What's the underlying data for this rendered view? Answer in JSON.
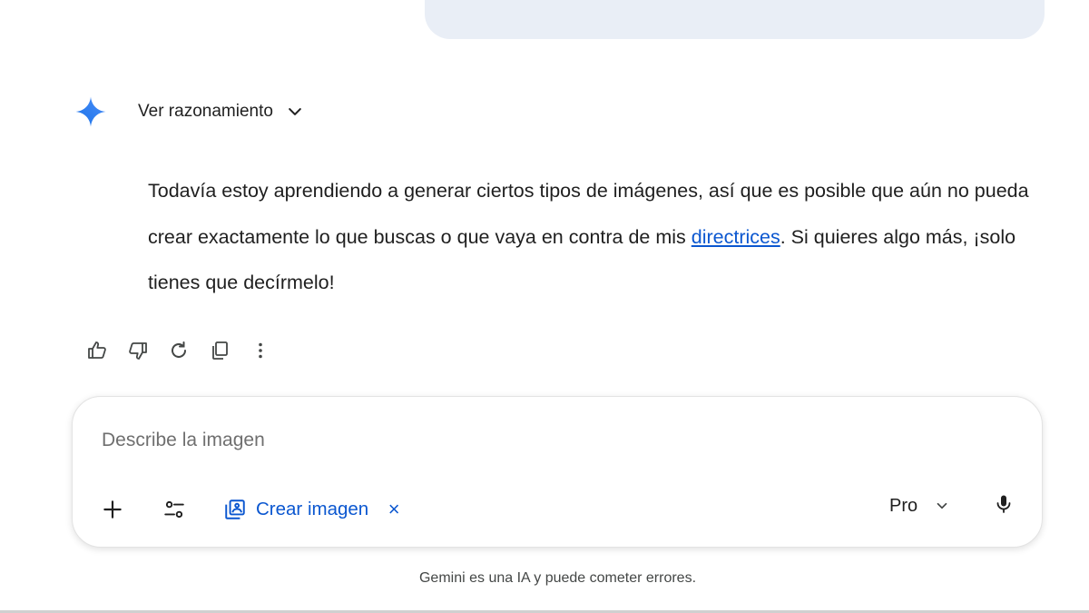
{
  "reasoning": {
    "label": "Ver razonamiento"
  },
  "answer": {
    "text_before_link": "Todavía estoy aprendiendo a generar ciertos tipos de imágenes, así que es posible que aún no pueda crear exactamente lo que buscas o que vaya en contra de mis ",
    "link_text": "directrices",
    "text_after_link": ". Si quieres algo más, ¡solo tienes que decírmelo!"
  },
  "actions": {
    "icons": [
      "thumb-up-icon",
      "thumb-down-icon",
      "regenerate-icon",
      "copy-icon",
      "more-vert-icon"
    ]
  },
  "composer": {
    "placeholder": "Describe la imagen",
    "chip_label": "Crear imagen",
    "chip_close": "×",
    "model_label": "Pro"
  },
  "footer": {
    "disclaimer": "Gemini es una IA y puede cometer errores."
  },
  "colors": {
    "accent": "#0b57d0",
    "bubble": "#e9eef6",
    "text": "#1f1f1f"
  }
}
